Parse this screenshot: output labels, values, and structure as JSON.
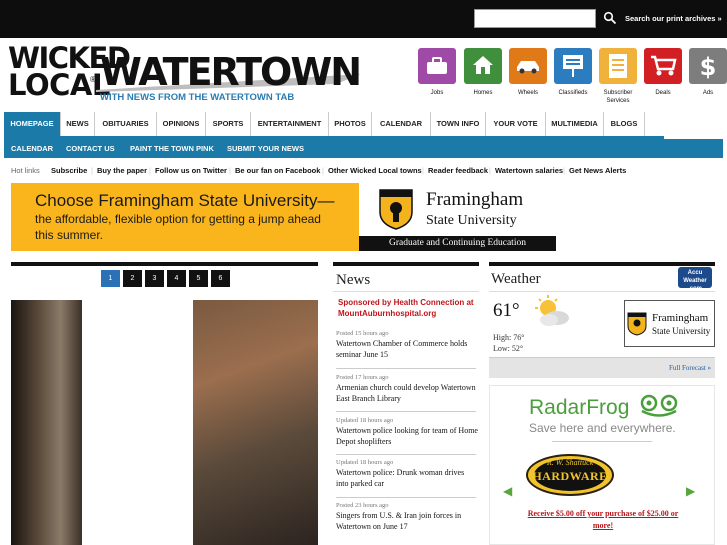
{
  "header": {
    "search_placeholder": "",
    "search_label": "Search our print archives »",
    "logo_wicked": "WICKED",
    "logo_local": "LOCAL",
    "logo_registered": "®",
    "site_name": "WATERTOWN",
    "tagline": "WITH NEWS FROM THE WATERTOWN TAB"
  },
  "quick_icons": [
    {
      "label": "Jobs",
      "color": "#a04aa8"
    },
    {
      "label": "Homes",
      "color": "#3f8f3c"
    },
    {
      "label": "Wheels",
      "color": "#e07a18"
    },
    {
      "label": "Classifieds",
      "color": "#2c7cc0"
    },
    {
      "label": "Subscriber Services",
      "color": "#f0b23a"
    },
    {
      "label": "Deals",
      "color": "#d11f24"
    },
    {
      "label": "Ads",
      "color": "#7d7d7d"
    }
  ],
  "main_nav": [
    "HOMEPAGE",
    "NEWS",
    "OBITUARIES",
    "OPINIONS",
    "SPORTS",
    "ENTERTAINMENT",
    "PHOTOS",
    "CALENDAR",
    "TOWN INFO",
    "YOUR VOTE",
    "MULTIMEDIA",
    "BLOGS"
  ],
  "sub_nav": [
    "CALENDAR",
    "CONTACT US",
    "PAINT THE TOWN PINK",
    "SUBMIT YOUR NEWS"
  ],
  "hot_links": {
    "title": "Hot links",
    "items": [
      "Subscribe",
      "Buy the paper",
      "Follow us on Twitter",
      "Be our fan on Facebook",
      "Other Wicked Local towns",
      "Reader feedback",
      "Watertown salaries",
      "Get News Alerts"
    ]
  },
  "banner_ad": {
    "headline": "Choose Framingham State University—",
    "line2": "the affordable, flexible option for getting a jump ahead",
    "line3": "this summer.",
    "school_line1": "Framingham",
    "school_line2": "State University",
    "bar_text": "Graduate and Continuing Education"
  },
  "slider": {
    "pages": [
      "1",
      "2",
      "3",
      "4",
      "5",
      "6"
    ],
    "active_page": "1"
  },
  "news": {
    "title": "News",
    "sponsor": "Sponsored by Health Connection at MountAuburnhospital.org",
    "items": [
      {
        "time": "Posted 15 hours ago",
        "headline": "Watertown Chamber of Commerce holds seminar June 15"
      },
      {
        "time": "Posted 17 hours ago",
        "headline": "Armenian church could develop Watertown East Branch Library"
      },
      {
        "time": "Updated 18 hours ago",
        "headline": "Watertown police looking for team of Home Depot shoplifters"
      },
      {
        "time": "Updated 18 hours ago",
        "headline": "Watertown police: Drunk woman drives into parked car"
      },
      {
        "time": "Posted 23 hours ago",
        "headline": "Singers from U.S. & Iran join forces in Watertown on June 17"
      }
    ]
  },
  "weather": {
    "title": "Weather",
    "accu_brand": "Accu Weather .com",
    "temperature": "61°",
    "high": "High: 76°",
    "low": "Low: 52°",
    "ad_line1": "Framingham",
    "ad_line2": "State University",
    "forecast_link": "Full Forecast »"
  },
  "radar_ad": {
    "brand": "RadarFrog",
    "tagline": "Save here and everywhere.",
    "store_top": "R. W. Shattuck",
    "store": "HARDWARE",
    "promo": "Receive $5.00 off your purchase of $25.00 or more!",
    "prev_arrow": "◀",
    "next_arrow": "▶"
  }
}
